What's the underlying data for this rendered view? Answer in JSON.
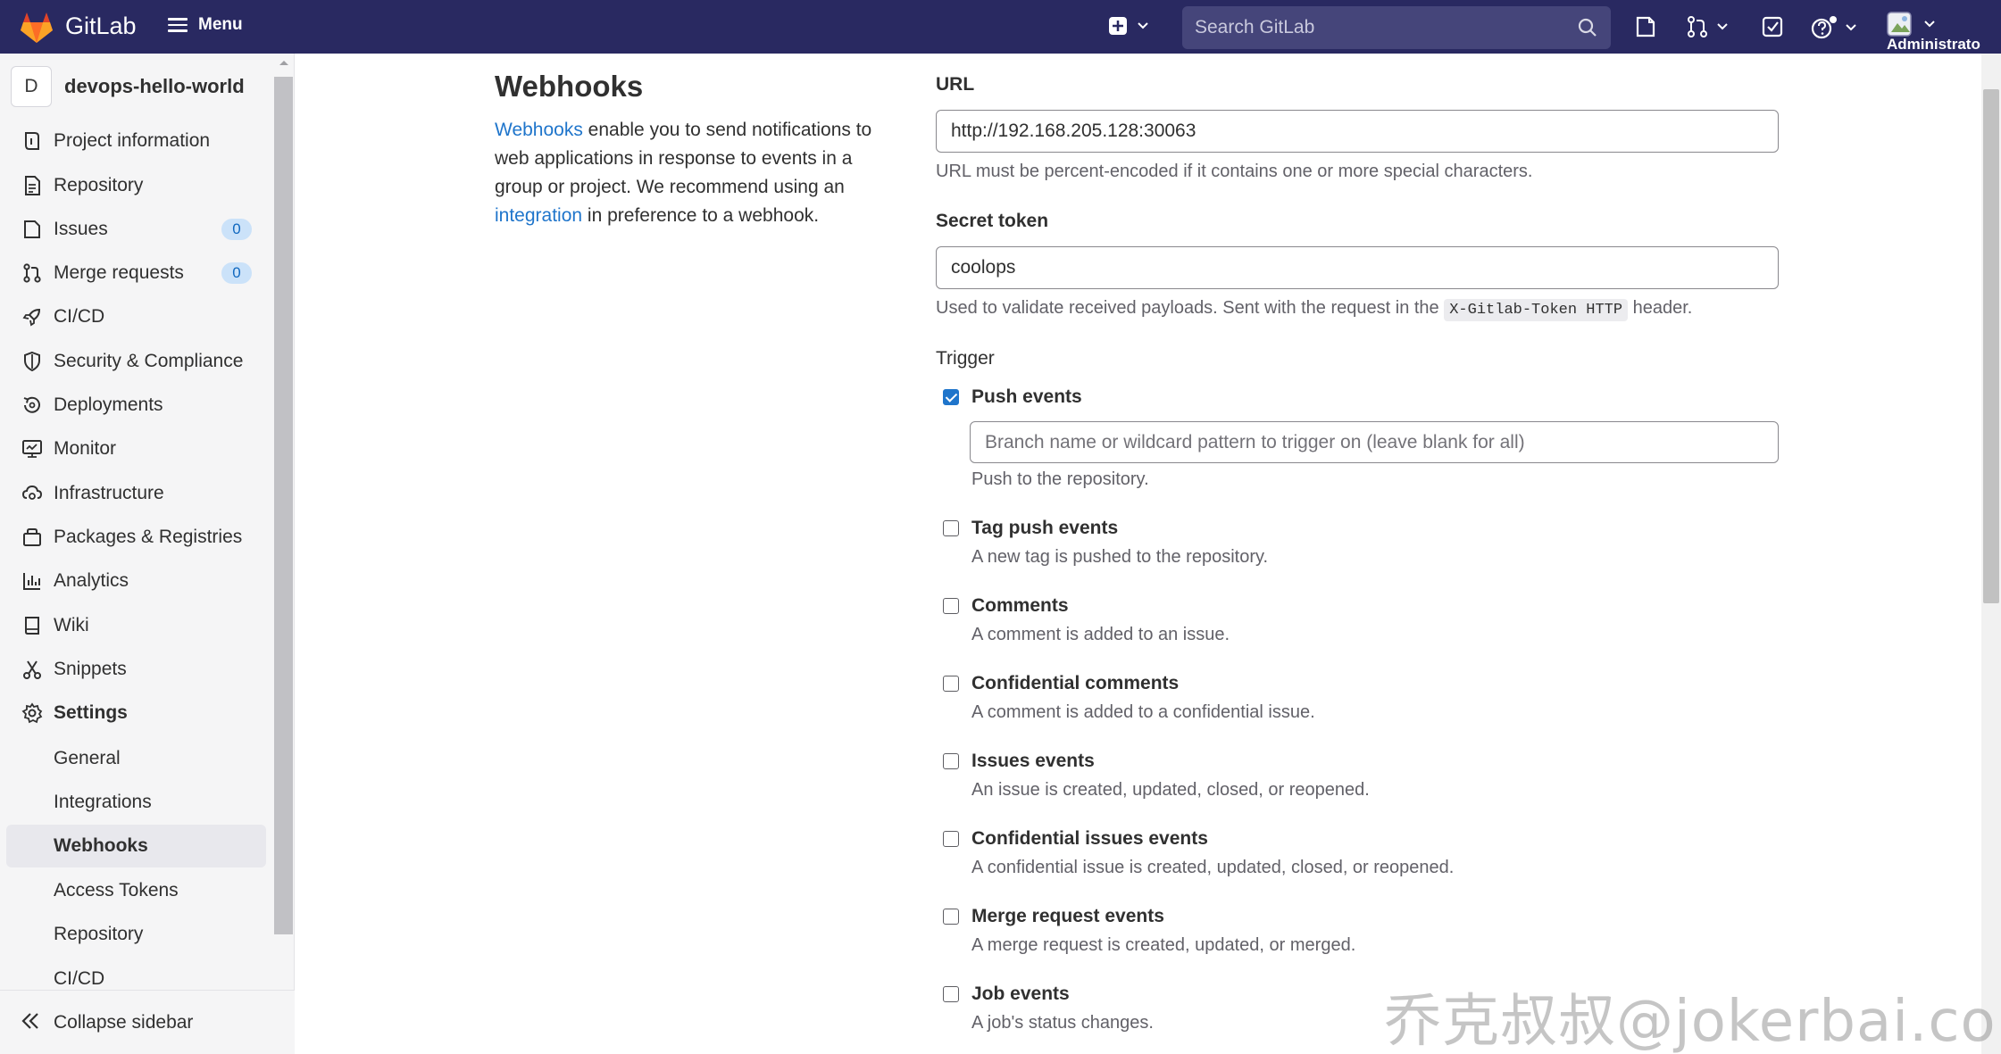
{
  "topbar": {
    "brand": "GitLab",
    "menu_label": "Menu",
    "search_placeholder": "Search GitLab",
    "user_label": "Administrato"
  },
  "sidebar": {
    "project_initial": "D",
    "project_name": "devops-hello-world",
    "items": [
      {
        "label": "Project information",
        "icon": "info-icon"
      },
      {
        "label": "Repository",
        "icon": "document-icon"
      },
      {
        "label": "Issues",
        "icon": "issues-icon",
        "badge": "0"
      },
      {
        "label": "Merge requests",
        "icon": "merge-request-icon",
        "badge": "0"
      },
      {
        "label": "CI/CD",
        "icon": "rocket-icon"
      },
      {
        "label": "Security & Compliance",
        "icon": "shield-icon"
      },
      {
        "label": "Deployments",
        "icon": "deployments-icon"
      },
      {
        "label": "Monitor",
        "icon": "monitor-icon"
      },
      {
        "label": "Infrastructure",
        "icon": "cloud-gear-icon"
      },
      {
        "label": "Packages & Registries",
        "icon": "package-icon"
      },
      {
        "label": "Analytics",
        "icon": "chart-icon"
      },
      {
        "label": "Wiki",
        "icon": "book-icon"
      },
      {
        "label": "Snippets",
        "icon": "scissors-icon"
      },
      {
        "label": "Settings",
        "icon": "gear-icon"
      }
    ],
    "settings_sub": [
      "General",
      "Integrations",
      "Webhooks",
      "Access Tokens",
      "Repository",
      "CI/CD"
    ],
    "active_sub": "Webhooks",
    "collapse_label": "Collapse sidebar"
  },
  "intro": {
    "title": "Webhooks",
    "link1": "Webhooks",
    "text1": " enable you to send notifications to web applications in response to events in a group or project. We recommend using an ",
    "link2": "integration",
    "text2": " in preference to a webhook."
  },
  "form": {
    "url_label": "URL",
    "url_value": "http://192.168.205.128:30063",
    "url_help": "URL must be percent-encoded if it contains one or more special characters.",
    "token_label": "Secret token",
    "token_value": "coolops",
    "token_help_pre": "Used to validate received payloads. Sent with the request in the ",
    "token_help_code": "X-Gitlab-Token HTTP",
    "token_help_post": " header.",
    "trigger_label": "Trigger",
    "branch_placeholder": "Branch name or wildcard pattern to trigger on (leave blank for all)"
  },
  "events": [
    {
      "title": "Push events",
      "desc": "Push to the repository.",
      "checked": true
    },
    {
      "title": "Tag push events",
      "desc": "A new tag is pushed to the repository.",
      "checked": false
    },
    {
      "title": "Comments",
      "desc": "A comment is added to an issue.",
      "checked": false
    },
    {
      "title": "Confidential comments",
      "desc": "A comment is added to a confidential issue.",
      "checked": false
    },
    {
      "title": "Issues events",
      "desc": "An issue is created, updated, closed, or reopened.",
      "checked": false
    },
    {
      "title": "Confidential issues events",
      "desc": "A confidential issue is created, updated, closed, or reopened.",
      "checked": false
    },
    {
      "title": "Merge request events",
      "desc": "A merge request is created, updated, or merged.",
      "checked": false
    },
    {
      "title": "Job events",
      "desc": "A job's status changes.",
      "checked": false
    }
  ],
  "watermark": "乔克叔叔@jokerbai.com",
  "colors": {
    "navbar": "#292961",
    "link": "#1f75cb",
    "checkbox": "#1f75cb",
    "badge_bg": "#cbe2f9"
  }
}
